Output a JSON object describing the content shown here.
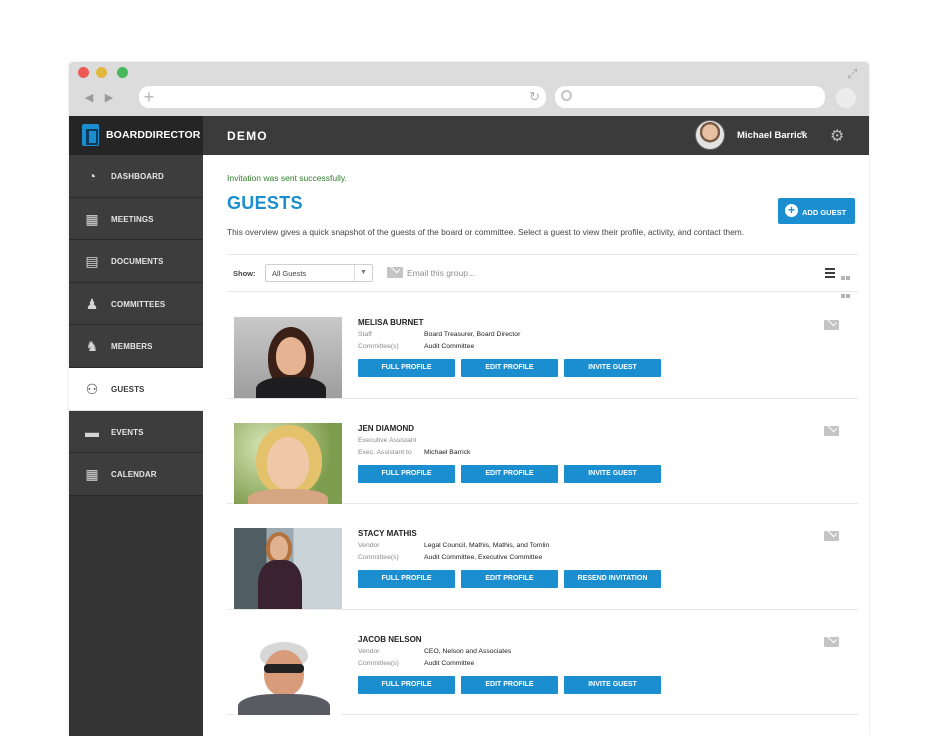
{
  "browser": {
    "nav_back": "◀",
    "nav_forward": "▶",
    "new_tab": "+",
    "reload": "↻"
  },
  "app": {
    "brand": "BOARDDIRECTOR",
    "org": "DEMO",
    "user": "Michael Barrick"
  },
  "sidebar": {
    "items": [
      {
        "label": "DASHBOARD",
        "icon": "dashboard-icon",
        "glyph": "◔"
      },
      {
        "label": "MEETINGS",
        "icon": "presentation-icon",
        "glyph": "▦"
      },
      {
        "label": "DOCUMENTS",
        "icon": "documents-icon",
        "glyph": "▤"
      },
      {
        "label": "COMMITTEES",
        "icon": "committees-icon",
        "glyph": "♟"
      },
      {
        "label": "MEMBERS",
        "icon": "members-icon",
        "glyph": "♞"
      },
      {
        "label": "GUESTS",
        "icon": "guests-icon",
        "glyph": "⚇"
      },
      {
        "label": "EVENTS",
        "icon": "events-icon",
        "glyph": "▬"
      },
      {
        "label": "CALENDAR",
        "icon": "calendar-icon",
        "glyph": "▦"
      }
    ],
    "active": "GUESTS"
  },
  "main": {
    "success": "Invitation was sent successfully.",
    "title": "GUESTS",
    "description": "This overview gives a quick snapshot of the guests of the board or committee. Select a guest to view their profile, activity, and contact them.",
    "add_button": "ADD GUEST",
    "filter": {
      "show_label": "Show:",
      "selected": "All Guests",
      "email_group": "Email this group..."
    }
  },
  "guests": [
    {
      "name": "MELISA BURNET",
      "rows": [
        {
          "k": "Staff",
          "v": "Board Treasurer, Board Director"
        },
        {
          "k": "Committee(s)",
          "v": "Audit Committee"
        }
      ],
      "buttons": [
        "FULL PROFILE",
        "EDIT PROFILE",
        "INVITE GUEST"
      ]
    },
    {
      "name": "JEN DIAMOND",
      "rows": [
        {
          "k": "Executive Assistant",
          "v": ""
        },
        {
          "k": "Exec. Assistant to",
          "v": "Michael Barrick"
        }
      ],
      "buttons": [
        "FULL PROFILE",
        "EDIT PROFILE",
        "INVITE GUEST"
      ]
    },
    {
      "name": "STACY MATHIS",
      "rows": [
        {
          "k": "Vendor",
          "v": "Legal Council, Mathis, Mathis, and Tomlin"
        },
        {
          "k": "Committee(s)",
          "v": "Audit Committee, Executive Committee"
        }
      ],
      "buttons": [
        "FULL PROFILE",
        "EDIT PROFILE",
        "RESEND INVITATION"
      ]
    },
    {
      "name": "JACOB NELSON",
      "rows": [
        {
          "k": "Vendor",
          "v": "CEO, Nelson and Associates"
        },
        {
          "k": "Committee(s)",
          "v": "Audit Committee"
        }
      ],
      "buttons": [
        "FULL PROFILE",
        "EDIT PROFILE",
        "INVITE GUEST"
      ]
    }
  ]
}
